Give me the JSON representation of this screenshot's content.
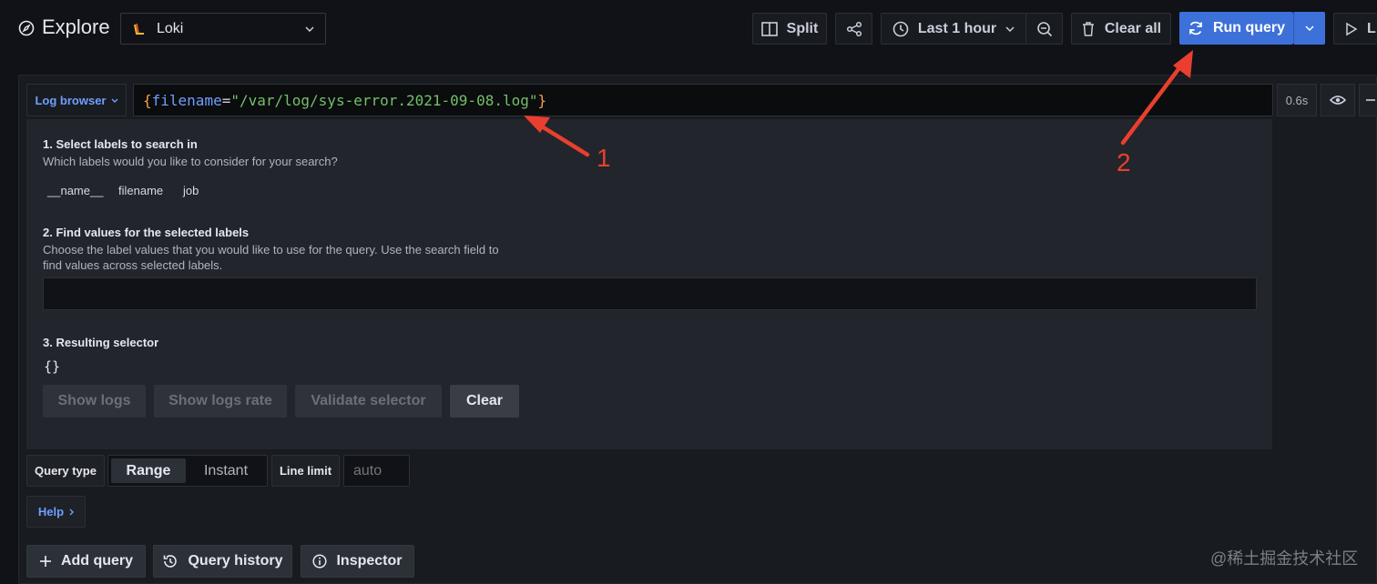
{
  "topbar": {
    "title": "Explore",
    "datasource": "Loki",
    "split_label": "Split",
    "time_range": "Last 1 hour",
    "clear_all_label": "Clear all",
    "run_query_label": "Run query",
    "live_label": "L"
  },
  "query_row": {
    "log_browser_label": "Log browser",
    "query": {
      "open_brace": "{",
      "label_key": "filename",
      "equals": "=",
      "label_value": "\"/var/log/sys-error.2021-09-08.log\"",
      "close_brace": "}"
    },
    "duration": "0.6s"
  },
  "browser": {
    "step1_title": "1. Select labels to search in",
    "step1_desc": "Which labels would you like to consider for your search?",
    "labels": [
      "__name__",
      "filename",
      "job"
    ],
    "step2_title": "2. Find values for the selected labels",
    "step2_desc_line1": "Choose the label values that you would like to use for the query. Use the search field to",
    "step2_desc_line2": "find values across selected labels.",
    "step2_search_value": "",
    "step3_title": "3. Resulting selector",
    "resulting_selector": "{}",
    "buttons": {
      "show_logs": "Show logs",
      "show_logs_rate": "Show logs rate",
      "validate_selector": "Validate selector",
      "clear": "Clear"
    }
  },
  "options": {
    "query_type_label": "Query type",
    "query_type_options": [
      "Range",
      "Instant"
    ],
    "query_type_selected": "Range",
    "line_limit_label": "Line limit",
    "line_limit_placeholder": "auto"
  },
  "help_label": "Help",
  "bottom": {
    "add_query": "Add query",
    "query_history": "Query history",
    "inspector": "Inspector"
  },
  "annotations": {
    "arrow1_label": "1",
    "arrow2_label": "2"
  },
  "watermark": "@稀土掘金技术社区",
  "colors": {
    "background": "#111217",
    "panel": "#181b1f",
    "run_query_blue": "#3d71d9",
    "link_blue": "#6e9fff",
    "brace_orange": "#f9a04f",
    "label_key_blue": "#6e9fff",
    "string_green": "#73bf69",
    "annotation_red": "#ea3f2e"
  }
}
